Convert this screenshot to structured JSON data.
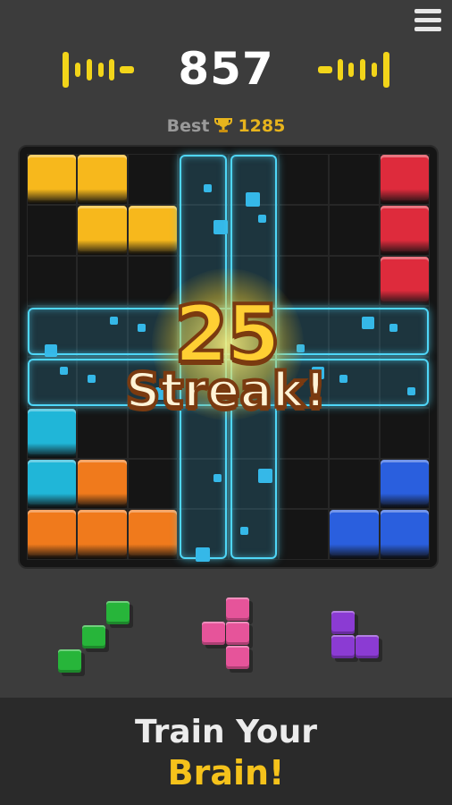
{
  "score": "857",
  "best": {
    "label": "Best",
    "value": "1285"
  },
  "streak": {
    "number": "25",
    "word": "Streak!"
  },
  "tagline": {
    "line1": "Train Your",
    "line2": "Brain!"
  },
  "colors": {
    "yellow": "#f7b81c",
    "red": "#de2b3c",
    "cyan": "#20b6d8",
    "orange": "#f07a1c",
    "blue": "#2a5fde",
    "green": "#27b53a",
    "pink": "#e6549a",
    "purple": "#8b3bd3",
    "glow": "#4fd6f7",
    "accent": "#f2d51a"
  },
  "board": {
    "rows": 8,
    "cols": 8,
    "blocks": [
      {
        "r": 0,
        "c": 0,
        "color": "yellow"
      },
      {
        "r": 0,
        "c": 1,
        "color": "yellow"
      },
      {
        "r": 1,
        "c": 1,
        "color": "yellow"
      },
      {
        "r": 1,
        "c": 2,
        "color": "yellow"
      },
      {
        "r": 0,
        "c": 7,
        "color": "red"
      },
      {
        "r": 1,
        "c": 7,
        "color": "red"
      },
      {
        "r": 2,
        "c": 7,
        "color": "red"
      },
      {
        "r": 5,
        "c": 0,
        "color": "cyan"
      },
      {
        "r": 6,
        "c": 0,
        "color": "cyan"
      },
      {
        "r": 6,
        "c": 1,
        "color": "orange"
      },
      {
        "r": 7,
        "c": 0,
        "color": "orange"
      },
      {
        "r": 7,
        "c": 1,
        "color": "orange"
      },
      {
        "r": 7,
        "c": 2,
        "color": "orange"
      },
      {
        "r": 6,
        "c": 7,
        "color": "blue"
      },
      {
        "r": 7,
        "c": 6,
        "color": "blue"
      },
      {
        "r": 7,
        "c": 7,
        "color": "blue"
      }
    ],
    "cleared_rows": [
      3,
      4
    ],
    "cleared_cols": [
      3,
      4
    ]
  },
  "pieces": [
    {
      "name": "green-s-piece",
      "color": "green",
      "cells": [
        [
          0,
          2
        ],
        [
          1,
          1
        ],
        [
          2,
          0
        ]
      ]
    },
    {
      "name": "pink-t-piece",
      "color": "pink",
      "cells": [
        [
          0,
          1
        ],
        [
          1,
          0
        ],
        [
          1,
          1
        ],
        [
          2,
          1
        ]
      ]
    },
    {
      "name": "purple-l-piece",
      "color": "purple",
      "cells": [
        [
          0,
          0
        ],
        [
          1,
          0
        ],
        [
          1,
          1
        ]
      ]
    }
  ]
}
